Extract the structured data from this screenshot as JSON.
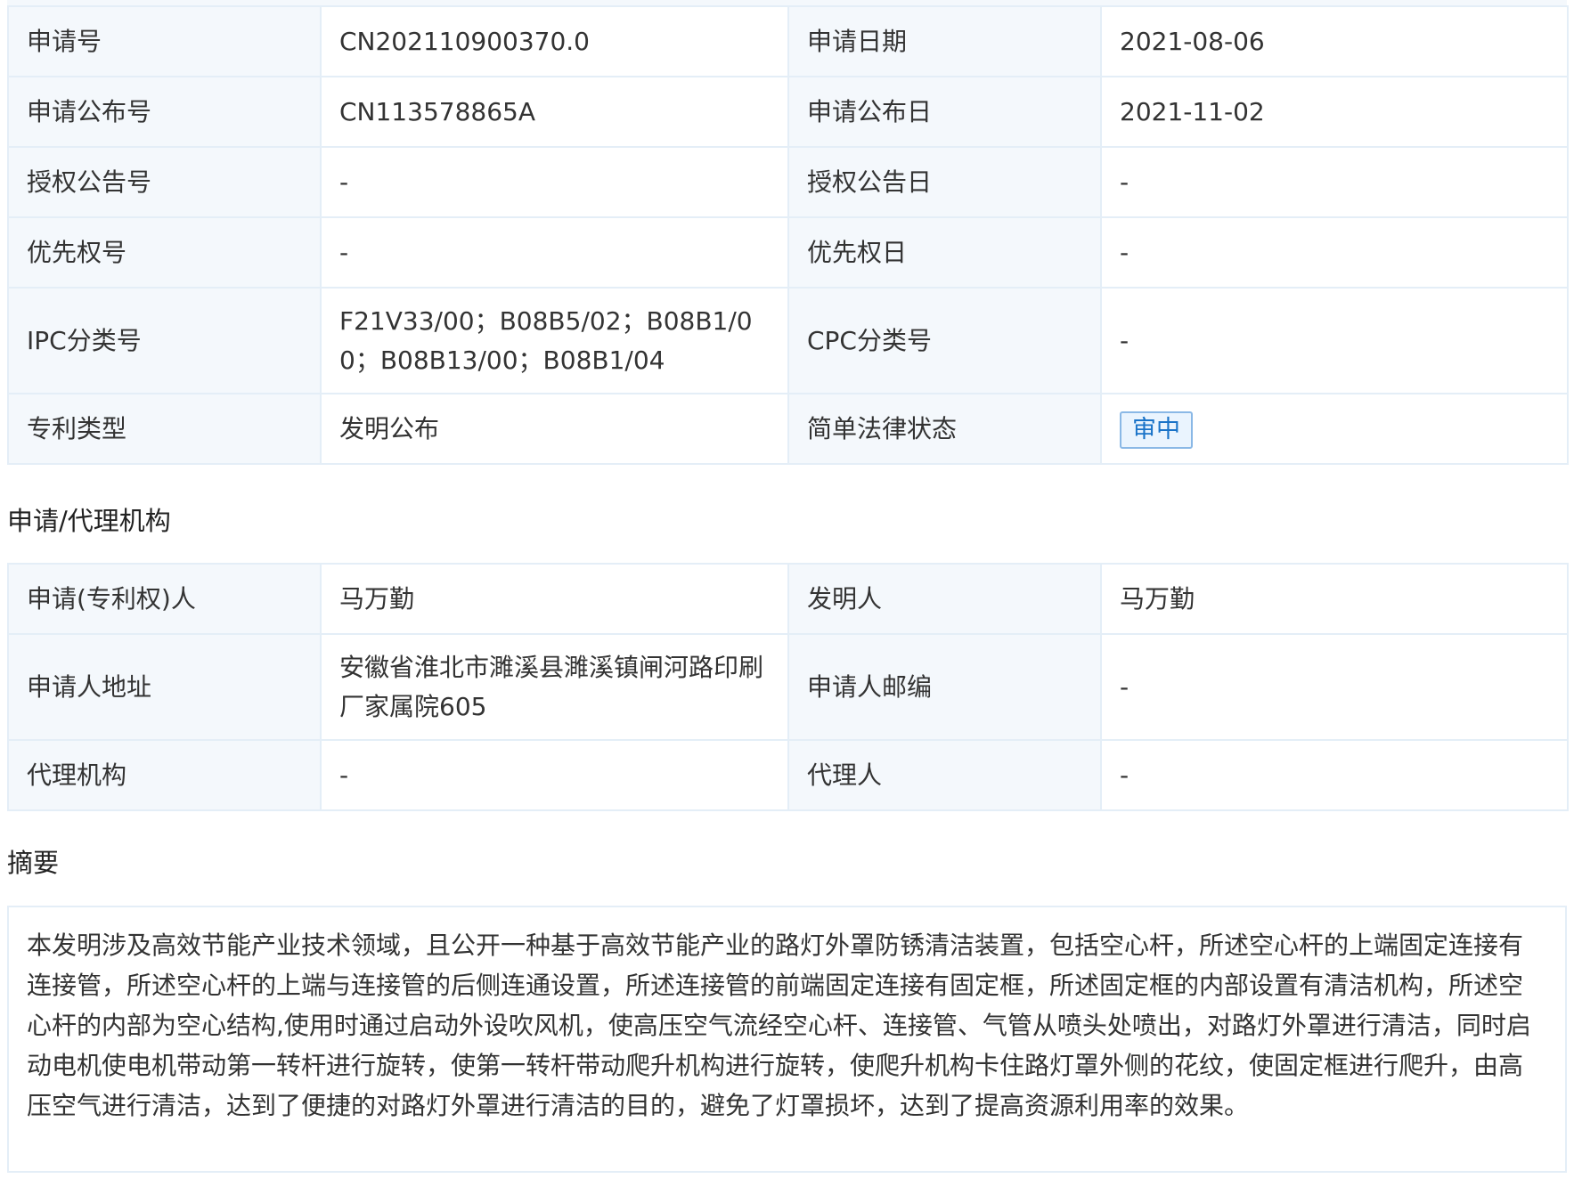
{
  "basic_info": {
    "rows": [
      {
        "l1": "申请号",
        "v1": "CN202110900370.0",
        "l2": "申请日期",
        "v2": "2021-08-06"
      },
      {
        "l1": "申请公布号",
        "v1": "CN113578865A",
        "l2": "申请公布日",
        "v2": "2021-11-02"
      },
      {
        "l1": "授权公告号",
        "v1": "-",
        "l2": "授权公告日",
        "v2": "-"
      },
      {
        "l1": "优先权号",
        "v1": "-",
        "l2": "优先权日",
        "v2": "-"
      },
      {
        "l1": "IPC分类号",
        "v1": "F21V33/00；B08B5/02；B08B1/00；B08B13/00；B08B1/04",
        "l2": "CPC分类号",
        "v2": "-"
      },
      {
        "l1": "专利类型",
        "v1": "发明公布",
        "l2": "简单法律状态",
        "v2": "审中"
      }
    ]
  },
  "agency": {
    "title": "申请/代理机构",
    "rows": [
      {
        "l1": "申请(专利权)人",
        "v1": "马万勤",
        "l2": "发明人",
        "v2": "马万勤"
      },
      {
        "l1": "申请人地址",
        "v1": "安徽省淮北市濉溪县濉溪镇闸河路印刷厂家属院605",
        "l2": "申请人邮编",
        "v2": "-"
      },
      {
        "l1": "代理机构",
        "v1": "-",
        "l2": "代理人",
        "v2": "-"
      }
    ]
  },
  "abstract": {
    "title": "摘要",
    "text": "本发明涉及高效节能产业技术领域，且公开一种基于高效节能产业的路灯外罩防锈清洁装置，包括空心杆，所述空心杆的上端固定连接有连接管，所述空心杆的上端与连接管的后侧连通设置，所述连接管的前端固定连接有固定框，所述固定框的内部设置有清洁机构，所述空心杆的内部为空心结构,使用时通过启动外设吹风机，使高压空气流经空心杆、连接管、气管从喷头处喷出，对路灯外罩进行清洁，同时启动电机使电机带动第一转杆进行旋转，使第一转杆带动爬升机构进行旋转，使爬升机构卡住路灯罩外侧的花纹，使固定框进行爬升，由高压空气进行清洁，达到了便捷的对路灯外罩进行清洁的目的，避免了灯罩损坏，达到了提高资源利用率的效果。"
  }
}
